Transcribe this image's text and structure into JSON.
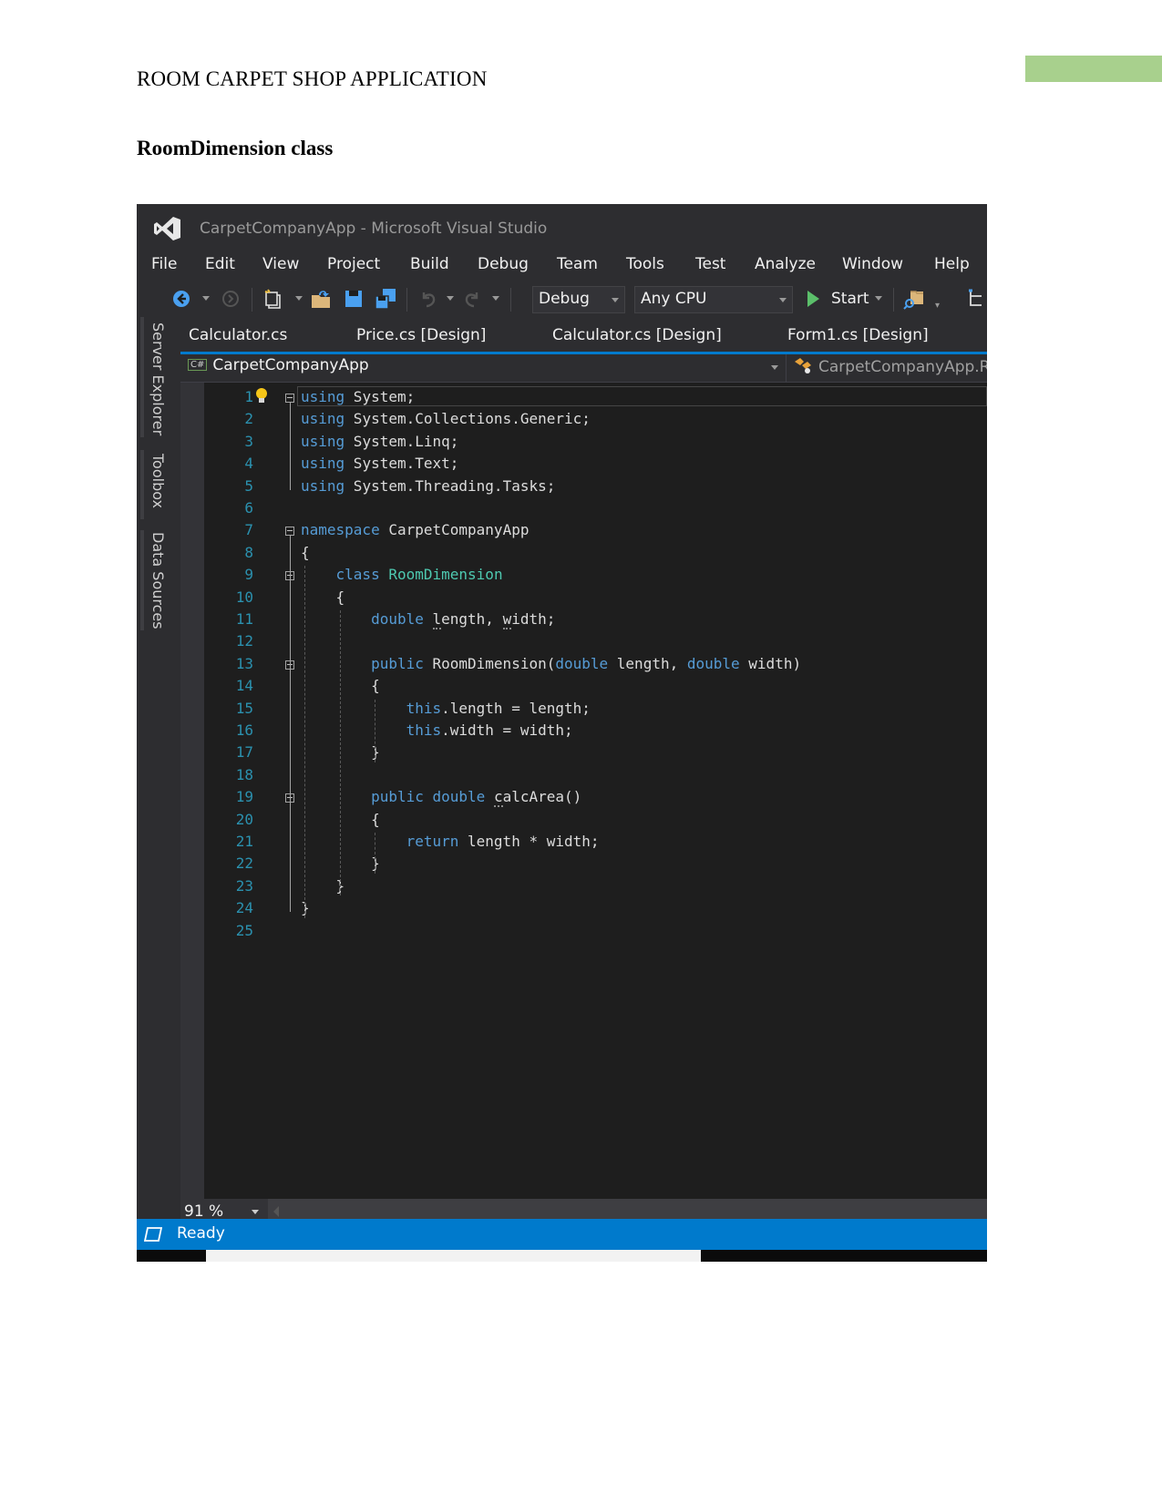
{
  "document": {
    "header_title": "ROOM CARPET SHOP APPLICATION",
    "section_title": "RoomDimension class",
    "accent_color": "#a8d08d"
  },
  "vs": {
    "window_title": "CarpetCompanyApp - Microsoft Visual Studio",
    "menu": [
      "File",
      "Edit",
      "View",
      "Project",
      "Build",
      "Debug",
      "Team",
      "Tools",
      "Test",
      "Analyze",
      "Window",
      "Help"
    ],
    "toolbar": {
      "configuration": "Debug",
      "platform": "Any CPU",
      "start_label": "Start",
      "icons": [
        "back-icon",
        "forward-icon",
        "new-project-icon",
        "open-file-icon",
        "save-icon",
        "save-all-icon",
        "undo-icon",
        "redo-icon",
        "start-icon",
        "find-in-files-icon"
      ]
    },
    "side_tabs": [
      "Server Explorer",
      "Toolbox",
      "Data Sources"
    ],
    "doc_tabs": [
      "Calculator.cs",
      "Price.cs [Design]",
      "Calculator.cs [Design]",
      "Form1.cs [Design]"
    ],
    "nav": {
      "project_badge": "C#",
      "project": "CarpetCompanyApp",
      "type_scope": "CarpetCompanyApp.R"
    },
    "code_lines": [
      {
        "n": "1",
        "html": "<span class=\"kw\">using</span> System;"
      },
      {
        "n": "2",
        "html": "<span class=\"kw\">using</span> System.Collections.Generic;"
      },
      {
        "n": "3",
        "html": "<span class=\"kw\">using</span> System.Linq;"
      },
      {
        "n": "4",
        "html": "<span class=\"kw\">using</span> System.Text;"
      },
      {
        "n": "5",
        "html": "<span class=\"kw\">using</span> System.Threading.Tasks;"
      },
      {
        "n": "6",
        "html": ""
      },
      {
        "n": "7",
        "html": "<span class=\"kw\">namespace</span> CarpetCompanyApp"
      },
      {
        "n": "8",
        "html": "{"
      },
      {
        "n": "9",
        "html": "    <span class=\"kw\">class</span> <span class=\"type\">RoomDimension</span>"
      },
      {
        "n": "10",
        "html": "    {"
      },
      {
        "n": "11",
        "html": "        <span class=\"kw\">double</span> <span class=\"squiggle\">l</span>ength, <span class=\"squiggle\">w</span>idth;"
      },
      {
        "n": "12",
        "html": ""
      },
      {
        "n": "13",
        "html": "        <span class=\"kw\">public</span> RoomDimension(<span class=\"kw\">double</span> length, <span class=\"kw\">double</span> width)"
      },
      {
        "n": "14",
        "html": "        {"
      },
      {
        "n": "15",
        "html": "            <span class=\"kw\">this</span>.length = length;"
      },
      {
        "n": "16",
        "html": "            <span class=\"kw\">this</span>.width = width;"
      },
      {
        "n": "17",
        "html": "        }"
      },
      {
        "n": "18",
        "html": ""
      },
      {
        "n": "19",
        "html": "        <span class=\"kw\">public</span> <span class=\"kw\">double</span> <span class=\"squiggle\">c</span>alcArea()"
      },
      {
        "n": "20",
        "html": "        {"
      },
      {
        "n": "21",
        "html": "            <span class=\"kw\">return</span> length * width;"
      },
      {
        "n": "22",
        "html": "        }"
      },
      {
        "n": "23",
        "html": "    }"
      },
      {
        "n": "24",
        "html": "}"
      },
      {
        "n": "25",
        "html": ""
      }
    ],
    "zoom_level": "91 %",
    "status": "Ready",
    "colors": {
      "editor_bg": "#1e1e1e",
      "chrome_bg": "#2d2d30",
      "keyword": "#569cd6",
      "type": "#4ec9b0",
      "line_number": "#2b91af",
      "status_bar": "#007acc"
    }
  }
}
